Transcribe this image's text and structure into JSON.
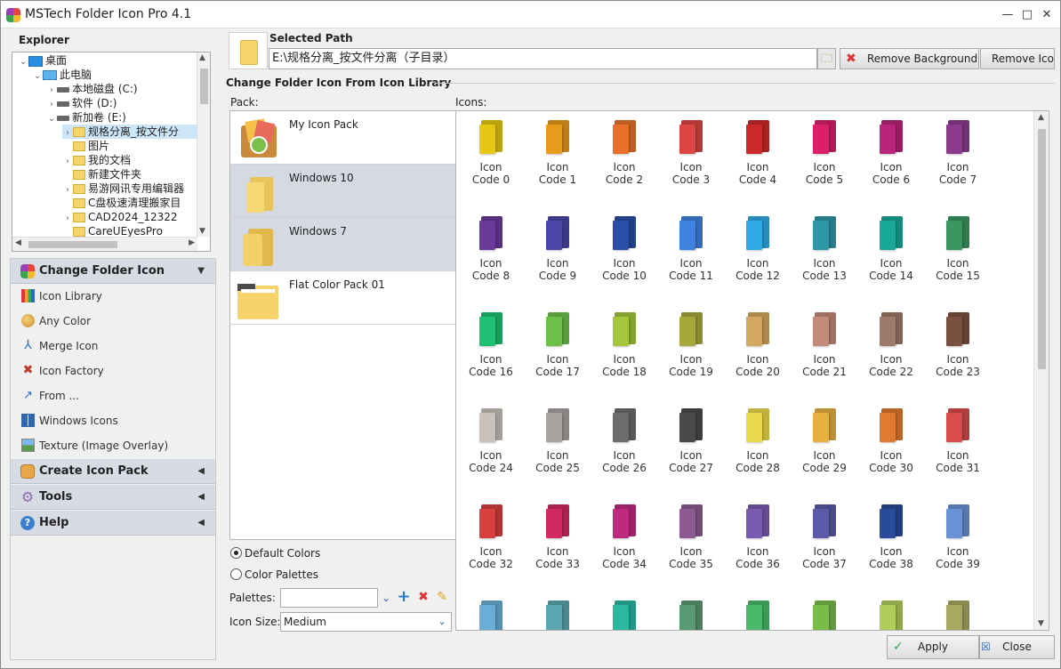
{
  "window": {
    "title": "MSTech Folder Icon Pro 4.1",
    "minimize": "—",
    "maximize": "□",
    "close": "✕"
  },
  "explorer": {
    "label": "Explorer",
    "tree": [
      {
        "label": "桌面",
        "arrow": "⌄",
        "level": 0
      },
      {
        "label": "此电脑",
        "arrow": "⌄",
        "level": 1
      },
      {
        "label": "本地磁盘 (C:)",
        "arrow": "›",
        "level": 2
      },
      {
        "label": "软件 (D:)",
        "arrow": "›",
        "level": 2
      },
      {
        "label": "新加卷 (E:)",
        "arrow": "⌄",
        "level": 2
      },
      {
        "label": "规格分离_按文件分",
        "arrow": "›",
        "level": 3
      },
      {
        "label": "图片",
        "arrow": "",
        "level": 3
      },
      {
        "label": "我的文档",
        "arrow": "›",
        "level": 3
      },
      {
        "label": "新建文件夹",
        "arrow": "",
        "level": 3
      },
      {
        "label": "易游网讯专用编辑器",
        "arrow": "›",
        "level": 3
      },
      {
        "label": "C盘极速清理搬家目",
        "arrow": "",
        "level": 3
      },
      {
        "label": "CAD2024_12322",
        "arrow": "›",
        "level": 3
      },
      {
        "label": "CareUEyesPro",
        "arrow": "",
        "level": 3
      }
    ]
  },
  "sidebar": {
    "groups": [
      {
        "label": "Change Folder Icon",
        "arrow": "▼"
      },
      {
        "label": "Create Icon Pack",
        "arrow": "◀"
      },
      {
        "label": "Tools",
        "arrow": "◀"
      },
      {
        "label": "Help",
        "arrow": "◀"
      }
    ],
    "items": [
      "Icon Library",
      "Any Color",
      "Merge Icon",
      "Icon Factory",
      "From ...",
      "Windows Icons",
      "Texture (Image Overlay)"
    ]
  },
  "path": {
    "label": "Selected Path",
    "value": "E:\\规格分离_按文件分离（子目录）",
    "remove_background": "Remove Background",
    "remove_icon": "Remove Icon"
  },
  "library": {
    "title": "Change Folder Icon From Icon Library",
    "pack_label": "Pack:",
    "icons_label": "Icons:",
    "packs": [
      "My Icon Pack",
      "Windows 10",
      "Windows 7",
      "Flat Color Pack 01"
    ],
    "default_colors": "Default Colors",
    "color_palettes": "Color Palettes",
    "palettes_label": "Palettes:",
    "palettes_value": "",
    "icon_size_label": "Icon Size:",
    "icon_size_value": "Medium",
    "icons": [
      {
        "line1": "Icon",
        "line2": "Code 0",
        "color": "#e6c713"
      },
      {
        "line1": "Icon",
        "line2": "Code 1",
        "color": "#e89a1a"
      },
      {
        "line1": "Icon",
        "line2": "Code 2",
        "color": "#e8702a"
      },
      {
        "line1": "Icon",
        "line2": "Code 3",
        "color": "#dd4444"
      },
      {
        "line1": "Icon",
        "line2": "Code 4",
        "color": "#cc2a2a"
      },
      {
        "line1": "Icon",
        "line2": "Code 5",
        "color": "#db1f6a"
      },
      {
        "line1": "Icon",
        "line2": "Code 6",
        "color": "#b8257a"
      },
      {
        "line1": "Icon",
        "line2": "Code 7",
        "color": "#8e3a8e"
      },
      {
        "line1": "Icon",
        "line2": "Code 8",
        "color": "#6a3a9a"
      },
      {
        "line1": "Icon",
        "line2": "Code 9",
        "color": "#4a45a8"
      },
      {
        "line1": "Icon",
        "line2": "Code 10",
        "color": "#2a4fa8"
      },
      {
        "line1": "Icon",
        "line2": "Code 11",
        "color": "#3f82e0"
      },
      {
        "line1": "Icon",
        "line2": "Code 12",
        "color": "#30a9e6"
      },
      {
        "line1": "Icon",
        "line2": "Code 13",
        "color": "#2e97a8"
      },
      {
        "line1": "Icon",
        "line2": "Code 14",
        "color": "#1aa898"
      },
      {
        "line1": "Icon",
        "line2": "Code 15",
        "color": "#3b9660"
      },
      {
        "line1": "Icon",
        "line2": "Code 16",
        "color": "#1fbf74"
      },
      {
        "line1": "Icon",
        "line2": "Code 17",
        "color": "#6cc04a"
      },
      {
        "line1": "Icon",
        "line2": "Code 18",
        "color": "#a3c63a"
      },
      {
        "line1": "Icon",
        "line2": "Code 19",
        "color": "#a8a83a"
      },
      {
        "line1": "Icon",
        "line2": "Code 20",
        "color": "#d4a860"
      },
      {
        "line1": "Icon",
        "line2": "Code 21",
        "color": "#c48a7a"
      },
      {
        "line1": "Icon",
        "line2": "Code 22",
        "color": "#9e7a6a"
      },
      {
        "line1": "Icon",
        "line2": "Code 23",
        "color": "#7a5040"
      },
      {
        "line1": "Icon",
        "line2": "Code 24",
        "color": "#c9c2bc"
      },
      {
        "line1": "Icon",
        "line2": "Code 25",
        "color": "#a8a2a0"
      },
      {
        "line1": "Icon",
        "line2": "Code 26",
        "color": "#6c6c6c"
      },
      {
        "line1": "Icon",
        "line2": "Code 27",
        "color": "#4a4a4a"
      },
      {
        "line1": "Icon",
        "line2": "Code 28",
        "color": "#ead94a"
      },
      {
        "line1": "Icon",
        "line2": "Code 29",
        "color": "#e8b040"
      },
      {
        "line1": "Icon",
        "line2": "Code 30",
        "color": "#e07a30"
      },
      {
        "line1": "Icon",
        "line2": "Code 31",
        "color": "#d84c4c"
      },
      {
        "line1": "Icon",
        "line2": "Code 32",
        "color": "#d84040"
      },
      {
        "line1": "Icon",
        "line2": "Code 33",
        "color": "#d22a60"
      },
      {
        "line1": "Icon",
        "line2": "Code 34",
        "color": "#c02a7e"
      },
      {
        "line1": "Icon",
        "line2": "Code 35",
        "color": "#8e5a92"
      },
      {
        "line1": "Icon",
        "line2": "Code 36",
        "color": "#7a5ab0"
      },
      {
        "line1": "Icon",
        "line2": "Code 37",
        "color": "#5a5aa8"
      },
      {
        "line1": "Icon",
        "line2": "Code 38",
        "color": "#2a4a9a"
      },
      {
        "line1": "Icon",
        "line2": "Code 39",
        "color": "#6a92d6"
      },
      {
        "line1": "",
        "line2": "",
        "color": "#6aaed6"
      },
      {
        "line1": "",
        "line2": "",
        "color": "#5aa6b0"
      },
      {
        "line1": "",
        "line2": "",
        "color": "#2ab8a0"
      },
      {
        "line1": "",
        "line2": "",
        "color": "#5a9a72"
      },
      {
        "line1": "",
        "line2": "",
        "color": "#4aba6a"
      },
      {
        "line1": "",
        "line2": "",
        "color": "#7abc4a"
      },
      {
        "line1": "",
        "line2": "",
        "color": "#b0cc5a"
      },
      {
        "line1": "",
        "line2": "",
        "color": "#a8a860"
      }
    ]
  },
  "footer": {
    "apply": "Apply",
    "close": "Close"
  },
  "colors": {
    "selected_pack": "#d5d9e1",
    "group_header": "#d7dbe3",
    "tree_selection": "#cde6f7"
  }
}
